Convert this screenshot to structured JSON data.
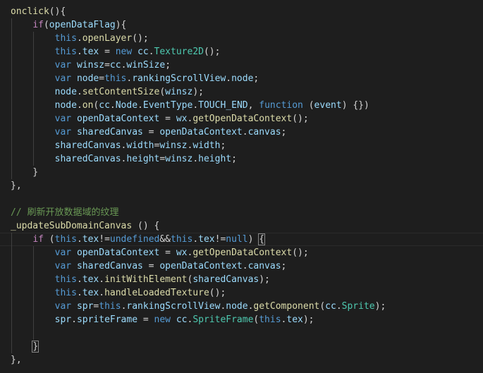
{
  "editor": {
    "colors": {
      "background": "#1e1e1e",
      "default": "#d4d4d4",
      "keyword": "#569cd6",
      "control": "#c586c0",
      "function": "#dcdcaa",
      "variable": "#9cdcfe",
      "type": "#4ec9b0",
      "comment": "#6a9955"
    },
    "lines": [
      [
        [
          "onclick",
          "function"
        ],
        [
          "(){",
          "default"
        ]
      ],
      [
        [
          "    ",
          "default"
        ],
        [
          "if",
          "control"
        ],
        [
          "(",
          "default"
        ],
        [
          "openDataFlag",
          "variable"
        ],
        [
          "){",
          "default"
        ]
      ],
      [
        [
          "        ",
          "default"
        ],
        [
          "this",
          "keyword"
        ],
        [
          ".",
          "default"
        ],
        [
          "openLayer",
          "function"
        ],
        [
          "();",
          "default"
        ]
      ],
      [
        [
          "        ",
          "default"
        ],
        [
          "this",
          "keyword"
        ],
        [
          ".",
          "default"
        ],
        [
          "tex",
          "variable"
        ],
        [
          " = ",
          "default"
        ],
        [
          "new",
          "keyword"
        ],
        [
          " ",
          "default"
        ],
        [
          "cc",
          "variable"
        ],
        [
          ".",
          "default"
        ],
        [
          "Texture2D",
          "type"
        ],
        [
          "();",
          "default"
        ]
      ],
      [
        [
          "        ",
          "default"
        ],
        [
          "var",
          "keyword"
        ],
        [
          " ",
          "default"
        ],
        [
          "winsz",
          "variable"
        ],
        [
          "=",
          "default"
        ],
        [
          "cc",
          "variable"
        ],
        [
          ".",
          "default"
        ],
        [
          "winSize",
          "variable"
        ],
        [
          ";",
          "default"
        ]
      ],
      [
        [
          "        ",
          "default"
        ],
        [
          "var",
          "keyword"
        ],
        [
          " ",
          "default"
        ],
        [
          "node",
          "variable"
        ],
        [
          "=",
          "default"
        ],
        [
          "this",
          "keyword"
        ],
        [
          ".",
          "default"
        ],
        [
          "rankingScrollView",
          "variable"
        ],
        [
          ".",
          "default"
        ],
        [
          "node",
          "variable"
        ],
        [
          ";",
          "default"
        ]
      ],
      [
        [
          "        ",
          "default"
        ],
        [
          "node",
          "variable"
        ],
        [
          ".",
          "default"
        ],
        [
          "setContentSize",
          "function"
        ],
        [
          "(",
          "default"
        ],
        [
          "winsz",
          "variable"
        ],
        [
          ");",
          "default"
        ]
      ],
      [
        [
          "        ",
          "default"
        ],
        [
          "node",
          "variable"
        ],
        [
          ".",
          "default"
        ],
        [
          "on",
          "function"
        ],
        [
          "(",
          "default"
        ],
        [
          "cc",
          "variable"
        ],
        [
          ".",
          "default"
        ],
        [
          "Node",
          "variable"
        ],
        [
          ".",
          "default"
        ],
        [
          "EventType",
          "variable"
        ],
        [
          ".",
          "default"
        ],
        [
          "TOUCH_END",
          "variable"
        ],
        [
          ", ",
          "default"
        ],
        [
          "function",
          "keyword"
        ],
        [
          " (",
          "default"
        ],
        [
          "event",
          "variable"
        ],
        [
          ") {})",
          "default"
        ]
      ],
      [
        [
          "        ",
          "default"
        ],
        [
          "var",
          "keyword"
        ],
        [
          " ",
          "default"
        ],
        [
          "openDataContext",
          "variable"
        ],
        [
          " = ",
          "default"
        ],
        [
          "wx",
          "variable"
        ],
        [
          ".",
          "default"
        ],
        [
          "getOpenDataContext",
          "function"
        ],
        [
          "();",
          "default"
        ]
      ],
      [
        [
          "        ",
          "default"
        ],
        [
          "var",
          "keyword"
        ],
        [
          " ",
          "default"
        ],
        [
          "sharedCanvas",
          "variable"
        ],
        [
          " = ",
          "default"
        ],
        [
          "openDataContext",
          "variable"
        ],
        [
          ".",
          "default"
        ],
        [
          "canvas",
          "variable"
        ],
        [
          ";",
          "default"
        ]
      ],
      [
        [
          "        ",
          "default"
        ],
        [
          "sharedCanvas",
          "variable"
        ],
        [
          ".",
          "default"
        ],
        [
          "width",
          "variable"
        ],
        [
          "=",
          "default"
        ],
        [
          "winsz",
          "variable"
        ],
        [
          ".",
          "default"
        ],
        [
          "width",
          "variable"
        ],
        [
          ";",
          "default"
        ]
      ],
      [
        [
          "        ",
          "default"
        ],
        [
          "sharedCanvas",
          "variable"
        ],
        [
          ".",
          "default"
        ],
        [
          "height",
          "variable"
        ],
        [
          "=",
          "default"
        ],
        [
          "winsz",
          "variable"
        ],
        [
          ".",
          "default"
        ],
        [
          "height",
          "variable"
        ],
        [
          ";",
          "default"
        ]
      ],
      [
        [
          "    }",
          "default"
        ]
      ],
      [
        [
          "},",
          "default"
        ]
      ],
      [
        [
          "",
          "default"
        ]
      ],
      [
        [
          "// 刷新开放数据域的纹理",
          "comment"
        ]
      ],
      [
        [
          "_updateSubDomainCanvas",
          "function"
        ],
        [
          " () {",
          "default"
        ]
      ],
      [
        [
          "    ",
          "default"
        ],
        [
          "if",
          "control"
        ],
        [
          " (",
          "default"
        ],
        [
          "this",
          "keyword"
        ],
        [
          ".",
          "default"
        ],
        [
          "tex",
          "variable"
        ],
        [
          "!=",
          "default"
        ],
        [
          "undefined",
          "keyword"
        ],
        [
          "&&",
          "default"
        ],
        [
          "this",
          "keyword"
        ],
        [
          ".",
          "default"
        ],
        [
          "tex",
          "variable"
        ],
        [
          "!=",
          "default"
        ],
        [
          "null",
          "keyword"
        ],
        [
          ") ",
          "default"
        ],
        [
          "{",
          "bracket"
        ]
      ],
      [
        [
          "        ",
          "default"
        ],
        [
          "var",
          "keyword"
        ],
        [
          " ",
          "default"
        ],
        [
          "openDataContext",
          "variable"
        ],
        [
          " = ",
          "default"
        ],
        [
          "wx",
          "variable"
        ],
        [
          ".",
          "default"
        ],
        [
          "getOpenDataContext",
          "function"
        ],
        [
          "();",
          "default"
        ]
      ],
      [
        [
          "        ",
          "default"
        ],
        [
          "var",
          "keyword"
        ],
        [
          " ",
          "default"
        ],
        [
          "sharedCanvas",
          "variable"
        ],
        [
          " = ",
          "default"
        ],
        [
          "openDataContext",
          "variable"
        ],
        [
          ".",
          "default"
        ],
        [
          "canvas",
          "variable"
        ],
        [
          ";",
          "default"
        ]
      ],
      [
        [
          "        ",
          "default"
        ],
        [
          "this",
          "keyword"
        ],
        [
          ".",
          "default"
        ],
        [
          "tex",
          "variable"
        ],
        [
          ".",
          "default"
        ],
        [
          "initWithElement",
          "function"
        ],
        [
          "(",
          "default"
        ],
        [
          "sharedCanvas",
          "variable"
        ],
        [
          ");",
          "default"
        ]
      ],
      [
        [
          "        ",
          "default"
        ],
        [
          "this",
          "keyword"
        ],
        [
          ".",
          "default"
        ],
        [
          "tex",
          "variable"
        ],
        [
          ".",
          "default"
        ],
        [
          "handleLoadedTexture",
          "function"
        ],
        [
          "();",
          "default"
        ]
      ],
      [
        [
          "        ",
          "default"
        ],
        [
          "var",
          "keyword"
        ],
        [
          " ",
          "default"
        ],
        [
          "spr",
          "variable"
        ],
        [
          "=",
          "default"
        ],
        [
          "this",
          "keyword"
        ],
        [
          ".",
          "default"
        ],
        [
          "rankingScrollView",
          "variable"
        ],
        [
          ".",
          "default"
        ],
        [
          "node",
          "variable"
        ],
        [
          ".",
          "default"
        ],
        [
          "getComponent",
          "function"
        ],
        [
          "(",
          "default"
        ],
        [
          "cc",
          "variable"
        ],
        [
          ".",
          "default"
        ],
        [
          "Sprite",
          "type"
        ],
        [
          ");",
          "default"
        ]
      ],
      [
        [
          "        ",
          "default"
        ],
        [
          "spr",
          "variable"
        ],
        [
          ".",
          "default"
        ],
        [
          "spriteFrame",
          "variable"
        ],
        [
          " = ",
          "default"
        ],
        [
          "new",
          "keyword"
        ],
        [
          " ",
          "default"
        ],
        [
          "cc",
          "variable"
        ],
        [
          ".",
          "default"
        ],
        [
          "SpriteFrame",
          "type"
        ],
        [
          "(",
          "default"
        ],
        [
          "this",
          "keyword"
        ],
        [
          ".",
          "default"
        ],
        [
          "tex",
          "variable"
        ],
        [
          ");",
          "default"
        ]
      ],
      [
        [
          "",
          "default"
        ]
      ],
      [
        [
          "    ",
          "default"
        ],
        [
          "}",
          "bracket"
        ]
      ],
      [
        [
          "},",
          "default"
        ]
      ]
    ]
  }
}
